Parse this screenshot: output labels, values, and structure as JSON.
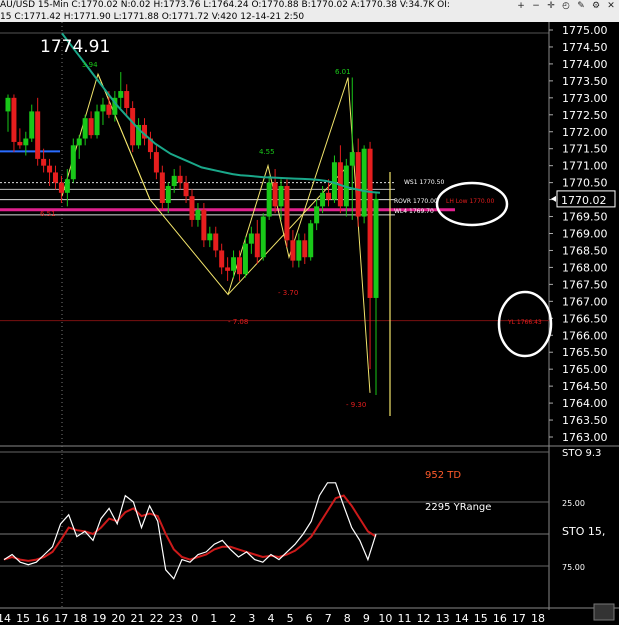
{
  "window": {
    "title": "AU/USD  15-Min  C:1770.02  N:0.02  H:1773.76  L:1764.24  O:1770.88  B:1770.02  A:1770.38  V:34.7K  OI:",
    "subtitle": "15  C:1771.42  H:1771.90  L:1771.88  O:1771.72  V:420  12-14-21  2:50",
    "toolbar_icons": [
      "zoom-in-icon",
      "zoom-out-icon",
      "crosshair-icon",
      "clock-icon",
      "draw-icon",
      "settings-icon",
      "close-icon"
    ]
  },
  "colors": {
    "up_candle": "#19c819",
    "down_candle": "#e61e1e",
    "ma_line": "#1aa88a",
    "stoch_k": "#ffffff",
    "stoch_d": "#cc1a1a",
    "pattern_line": "#f2e46b",
    "pivot_line": "#e0208e"
  },
  "price_panel": {
    "last_price_label": "1774.91",
    "current_price_tag": "1770.02",
    "y_ticks": [
      "1775.00",
      "1774.50",
      "1774.00",
      "1773.50",
      "1773.00",
      "1772.50",
      "1772.00",
      "1771.50",
      "1771.00",
      "1770.50",
      "1770.00",
      "1769.50",
      "1769.00",
      "1768.50",
      "1768.00",
      "1767.50",
      "1767.00",
      "1766.50",
      "1766.00",
      "1765.50",
      "1765.00",
      "1764.50",
      "1764.00",
      "1763.50",
      "1763.00"
    ],
    "pattern_labels": {
      "p1": "3.94",
      "p2": "6.51",
      "p3": "- 7.08",
      "p4": "4.55",
      "p5": "- 3.70",
      "p6": "6.01",
      "p7": "- 9.30"
    },
    "level_labels": {
      "ws1": "WS1  1770.50",
      "rovr": "ROVR  1770.00",
      "lh_low": "LH Low  1770.00",
      "wl4": "WL4  1769.70",
      "yl": "YL  1766.43"
    }
  },
  "stoch_panel": {
    "td_label": "952 TD",
    "range_label": "2295 YRange",
    "indicator_label": "STO  15,",
    "top_label": "STO  9.3",
    "y_ticks": [
      "25.00",
      "75.00"
    ]
  },
  "x_axis": {
    "ticks": [
      "14",
      "15",
      "16",
      "17",
      "18",
      "19",
      "20",
      "21",
      "22",
      "23",
      "0",
      "1",
      "2",
      "3",
      "4",
      "5",
      "6",
      "7",
      "8",
      "9",
      "10",
      "11",
      "12",
      "13",
      "14",
      "15",
      "16",
      "17",
      "18"
    ]
  },
  "chart_data": {
    "type": "candlestick",
    "x_labels": [
      "14",
      "15",
      "16",
      "17",
      "18",
      "19",
      "20",
      "21",
      "22",
      "23",
      "0",
      "1",
      "2",
      "3",
      "4",
      "5",
      "6",
      "7",
      "8",
      "9",
      "10",
      "11",
      "12",
      "13",
      "14",
      "15",
      "16",
      "17",
      "18"
    ],
    "ylim": [
      1763.0,
      1775.0
    ],
    "last_price": 1770.02,
    "candles": [
      {
        "o": 1772.6,
        "h": 1773.1,
        "l": 1772.0,
        "c": 1773.0
      },
      {
        "o": 1773.0,
        "h": 1773.1,
        "l": 1771.4,
        "c": 1771.7
      },
      {
        "o": 1771.7,
        "h": 1772.1,
        "l": 1771.5,
        "c": 1771.6
      },
      {
        "o": 1771.6,
        "h": 1772.0,
        "l": 1771.3,
        "c": 1771.8
      },
      {
        "o": 1771.8,
        "h": 1772.8,
        "l": 1771.7,
        "c": 1772.6
      },
      {
        "o": 1772.6,
        "h": 1773.0,
        "l": 1771.0,
        "c": 1771.2
      },
      {
        "o": 1771.2,
        "h": 1771.5,
        "l": 1770.8,
        "c": 1771.0
      },
      {
        "o": 1771.0,
        "h": 1771.2,
        "l": 1770.4,
        "c": 1770.8
      },
      {
        "o": 1770.8,
        "h": 1771.0,
        "l": 1770.3,
        "c": 1770.5
      },
      {
        "o": 1770.5,
        "h": 1770.7,
        "l": 1769.9,
        "c": 1770.2
      },
      {
        "o": 1770.2,
        "h": 1770.9,
        "l": 1769.8,
        "c": 1770.6
      },
      {
        "o": 1770.6,
        "h": 1771.8,
        "l": 1770.5,
        "c": 1771.6
      },
      {
        "o": 1771.6,
        "h": 1771.9,
        "l": 1771.2,
        "c": 1771.8
      },
      {
        "o": 1771.8,
        "h": 1772.5,
        "l": 1771.6,
        "c": 1772.4
      },
      {
        "o": 1772.4,
        "h": 1772.6,
        "l": 1771.8,
        "c": 1771.9
      },
      {
        "o": 1771.9,
        "h": 1772.8,
        "l": 1771.8,
        "c": 1772.6
      },
      {
        "o": 1772.6,
        "h": 1773.0,
        "l": 1772.2,
        "c": 1772.8
      },
      {
        "o": 1772.8,
        "h": 1773.2,
        "l": 1772.4,
        "c": 1772.5
      },
      {
        "o": 1772.5,
        "h": 1773.2,
        "l": 1772.3,
        "c": 1773.0
      },
      {
        "o": 1773.0,
        "h": 1773.76,
        "l": 1772.7,
        "c": 1773.2
      },
      {
        "o": 1773.2,
        "h": 1773.4,
        "l": 1772.5,
        "c": 1772.7
      },
      {
        "o": 1772.7,
        "h": 1772.9,
        "l": 1771.4,
        "c": 1771.6
      },
      {
        "o": 1771.6,
        "h": 1772.4,
        "l": 1771.5,
        "c": 1772.2
      },
      {
        "o": 1772.2,
        "h": 1772.4,
        "l": 1771.6,
        "c": 1771.8
      },
      {
        "o": 1771.8,
        "h": 1772.0,
        "l": 1771.2,
        "c": 1771.4
      },
      {
        "o": 1771.4,
        "h": 1771.6,
        "l": 1770.6,
        "c": 1770.8
      },
      {
        "o": 1770.8,
        "h": 1771.0,
        "l": 1769.7,
        "c": 1769.9
      },
      {
        "o": 1769.9,
        "h": 1770.5,
        "l": 1769.6,
        "c": 1770.4
      },
      {
        "o": 1770.4,
        "h": 1770.9,
        "l": 1770.2,
        "c": 1770.7
      },
      {
        "o": 1770.7,
        "h": 1771.0,
        "l": 1770.3,
        "c": 1770.5
      },
      {
        "o": 1770.5,
        "h": 1770.7,
        "l": 1769.9,
        "c": 1770.1
      },
      {
        "o": 1770.1,
        "h": 1770.3,
        "l": 1769.2,
        "c": 1769.4
      },
      {
        "o": 1769.4,
        "h": 1769.9,
        "l": 1769.2,
        "c": 1769.7
      },
      {
        "o": 1769.7,
        "h": 1769.9,
        "l": 1768.6,
        "c": 1768.8
      },
      {
        "o": 1768.8,
        "h": 1769.2,
        "l": 1768.6,
        "c": 1769.0
      },
      {
        "o": 1769.0,
        "h": 1769.2,
        "l": 1768.3,
        "c": 1768.5
      },
      {
        "o": 1768.5,
        "h": 1768.7,
        "l": 1767.8,
        "c": 1768.0
      },
      {
        "o": 1768.0,
        "h": 1768.3,
        "l": 1767.6,
        "c": 1767.9
      },
      {
        "o": 1767.9,
        "h": 1768.5,
        "l": 1767.7,
        "c": 1768.3
      },
      {
        "o": 1768.3,
        "h": 1768.5,
        "l": 1767.6,
        "c": 1767.8
      },
      {
        "o": 1767.8,
        "h": 1768.9,
        "l": 1767.7,
        "c": 1768.7
      },
      {
        "o": 1768.7,
        "h": 1769.2,
        "l": 1768.4,
        "c": 1769.0
      },
      {
        "o": 1769.0,
        "h": 1769.4,
        "l": 1768.1,
        "c": 1768.3
      },
      {
        "o": 1768.3,
        "h": 1769.6,
        "l": 1768.2,
        "c": 1769.5
      },
      {
        "o": 1769.5,
        "h": 1770.7,
        "l": 1769.4,
        "c": 1770.5
      },
      {
        "o": 1770.5,
        "h": 1770.9,
        "l": 1769.6,
        "c": 1769.8
      },
      {
        "o": 1769.8,
        "h": 1770.6,
        "l": 1769.4,
        "c": 1770.4
      },
      {
        "o": 1770.4,
        "h": 1770.6,
        "l": 1768.6,
        "c": 1768.8
      },
      {
        "o": 1768.8,
        "h": 1769.1,
        "l": 1768.0,
        "c": 1768.2
      },
      {
        "o": 1768.2,
        "h": 1769.0,
        "l": 1768.0,
        "c": 1768.8
      },
      {
        "o": 1768.8,
        "h": 1769.0,
        "l": 1768.1,
        "c": 1768.3
      },
      {
        "o": 1768.3,
        "h": 1769.4,
        "l": 1768.2,
        "c": 1769.3
      },
      {
        "o": 1769.3,
        "h": 1770.0,
        "l": 1769.1,
        "c": 1769.8
      },
      {
        "o": 1769.8,
        "h": 1770.4,
        "l": 1769.6,
        "c": 1770.2
      },
      {
        "o": 1770.2,
        "h": 1770.6,
        "l": 1769.8,
        "c": 1770.0
      },
      {
        "o": 1770.0,
        "h": 1771.3,
        "l": 1769.9,
        "c": 1771.1
      },
      {
        "o": 1771.1,
        "h": 1771.6,
        "l": 1769.6,
        "c": 1769.8
      },
      {
        "o": 1769.8,
        "h": 1771.2,
        "l": 1769.5,
        "c": 1771.0
      },
      {
        "o": 1771.0,
        "h": 1773.6,
        "l": 1769.4,
        "c": 1771.4
      },
      {
        "o": 1771.4,
        "h": 1771.8,
        "l": 1769.2,
        "c": 1769.5
      },
      {
        "o": 1769.5,
        "h": 1771.6,
        "l": 1769.3,
        "c": 1771.5
      },
      {
        "o": 1771.5,
        "h": 1771.7,
        "l": 1765.0,
        "c": 1767.1
      },
      {
        "o": 1767.1,
        "h": 1770.2,
        "l": 1764.24,
        "c": 1770.02
      }
    ],
    "ma_line": [
      1774.9,
      1774.6,
      1774.3,
      1774.0,
      1773.7,
      1773.4,
      1773.1,
      1772.8,
      1772.55,
      1772.3,
      1772.05,
      1771.85,
      1771.65,
      1771.5,
      1771.35,
      1771.25,
      1771.15,
      1771.05,
      1770.95,
      1770.9,
      1770.85,
      1770.8,
      1770.75,
      1770.72,
      1770.7,
      1770.68,
      1770.66,
      1770.65,
      1770.64,
      1770.63,
      1770.62,
      1770.61,
      1770.6,
      1770.58,
      1770.55,
      1770.5,
      1770.42,
      1770.35,
      1770.3,
      1770.25,
      1770.22,
      1770.2
    ],
    "horizontal_levels": [
      {
        "label": "WS1",
        "value": 1770.5
      },
      {
        "label": "ROVR",
        "value": 1770.0
      },
      {
        "label": "WL4",
        "value": 1769.7
      },
      {
        "label": "YL",
        "value": 1766.43
      }
    ],
    "stoch_k": [
      70,
      66,
      72,
      74,
      72,
      66,
      60,
      42,
      35,
      52,
      48,
      55,
      38,
      30,
      42,
      20,
      25,
      45,
      28,
      40,
      78,
      85,
      70,
      72,
      66,
      64,
      58,
      55,
      62,
      68,
      64,
      70,
      72,
      66,
      70,
      64,
      58,
      50,
      40,
      20,
      10,
      10,
      28,
      45,
      55,
      70,
      50
    ],
    "stoch_d": [
      70,
      68,
      70,
      71,
      70,
      68,
      64,
      55,
      45,
      47,
      48,
      50,
      45,
      38,
      40,
      33,
      30,
      36,
      34,
      36,
      50,
      62,
      68,
      70,
      68,
      66,
      62,
      60,
      60,
      62,
      64,
      66,
      68,
      67,
      68,
      66,
      63,
      58,
      52,
      42,
      32,
      22,
      20,
      28,
      38,
      48,
      52
    ]
  }
}
